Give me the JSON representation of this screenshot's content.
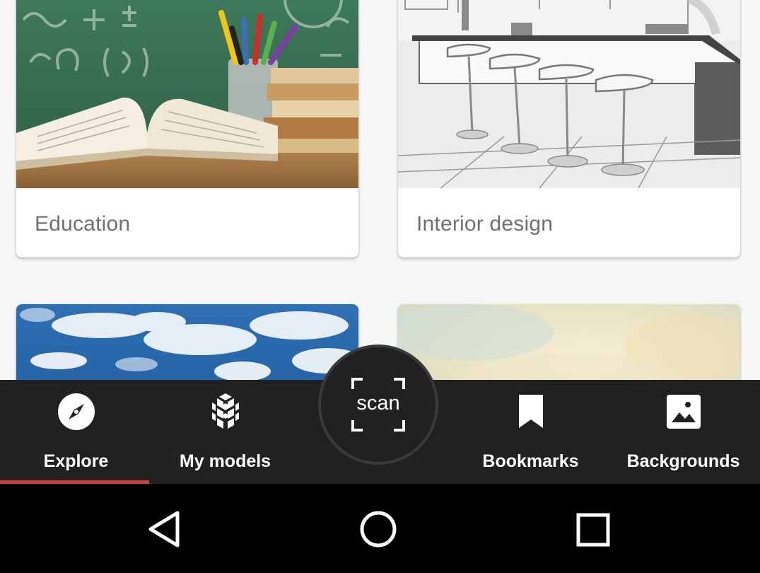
{
  "categories": [
    {
      "label": "Education",
      "image": "books-and-chalkboard"
    },
    {
      "label": "Interior design",
      "image": "kitchen-bar-stools-sketch"
    },
    {
      "label": "",
      "image": "blue-sky-clouds"
    },
    {
      "label": "",
      "image": "pastel-watercolor"
    }
  ],
  "bottom_nav": {
    "items": [
      {
        "label": "Explore",
        "icon": "compass-icon",
        "selected": true
      },
      {
        "label": "My models",
        "icon": "cubes-icon",
        "selected": false
      },
      {
        "label": "Bookmarks",
        "icon": "bookmark-icon",
        "selected": false
      },
      {
        "label": "Backgrounds",
        "icon": "image-icon",
        "selected": false
      }
    ],
    "scan": {
      "label": "scan",
      "icon": "scan-frame-icon"
    }
  },
  "system_nav": {
    "back_icon": "back-triangle-icon",
    "home_icon": "home-circle-icon",
    "recents_icon": "recents-square-icon"
  },
  "colors": {
    "nav_background": "#212121",
    "accent_indicator": "#c9413f",
    "card_label": "#707070",
    "page_background": "#f6f6f6"
  }
}
